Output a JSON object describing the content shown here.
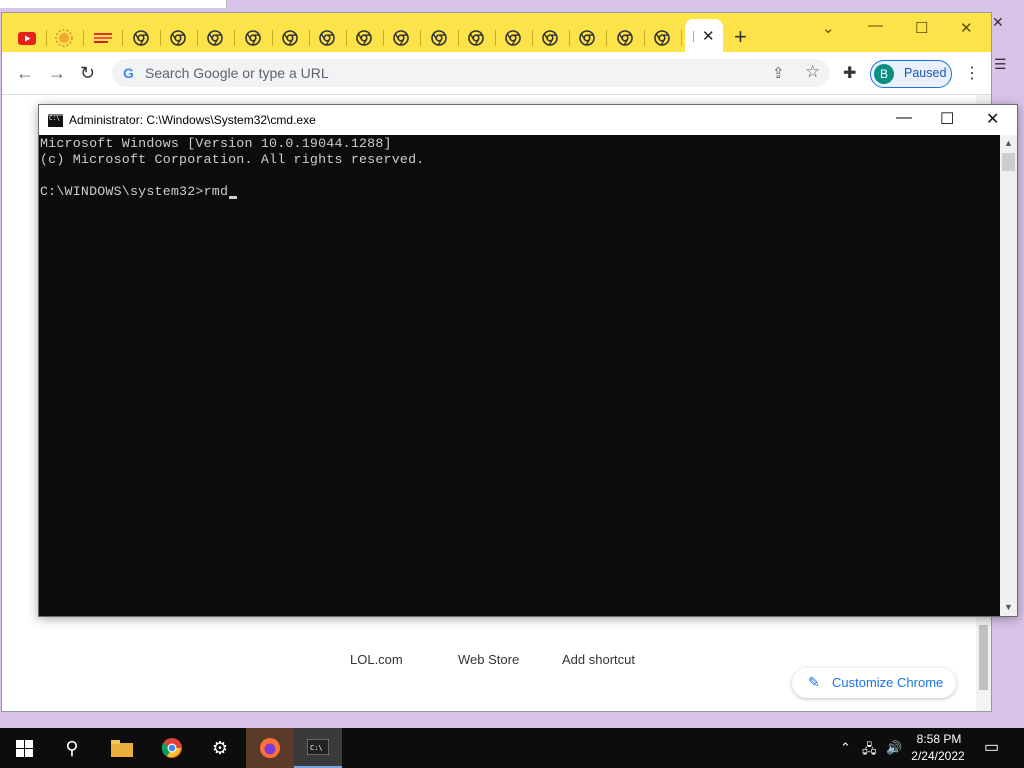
{
  "browser": {
    "tabs_count": 18,
    "omnibox_placeholder": "Search Google or type a URL",
    "profile_initial": "B",
    "profile_label": "Paused",
    "new_tab_symbol": "+",
    "active_tab_close": "✕"
  },
  "ntp": {
    "shortcuts": [
      "LOL.com",
      "Web Store",
      "Add shortcut"
    ],
    "customize_label": "Customize Chrome"
  },
  "cmd": {
    "title": "Administrator: C:\\Windows\\System32\\cmd.exe",
    "lines": [
      "Microsoft Windows [Version 10.0.19044.1288]",
      "(c) Microsoft Corporation. All rights reserved.",
      "",
      "C:\\WINDOWS\\system32>rmd"
    ]
  },
  "taskbar": {
    "time": "8:58 PM",
    "date": "2/24/2022"
  },
  "colors": {
    "tabstrip": "#fce34a",
    "console_bg": "#0c0c0c",
    "console_text": "#cccccc",
    "accent": "#1a73e8"
  }
}
